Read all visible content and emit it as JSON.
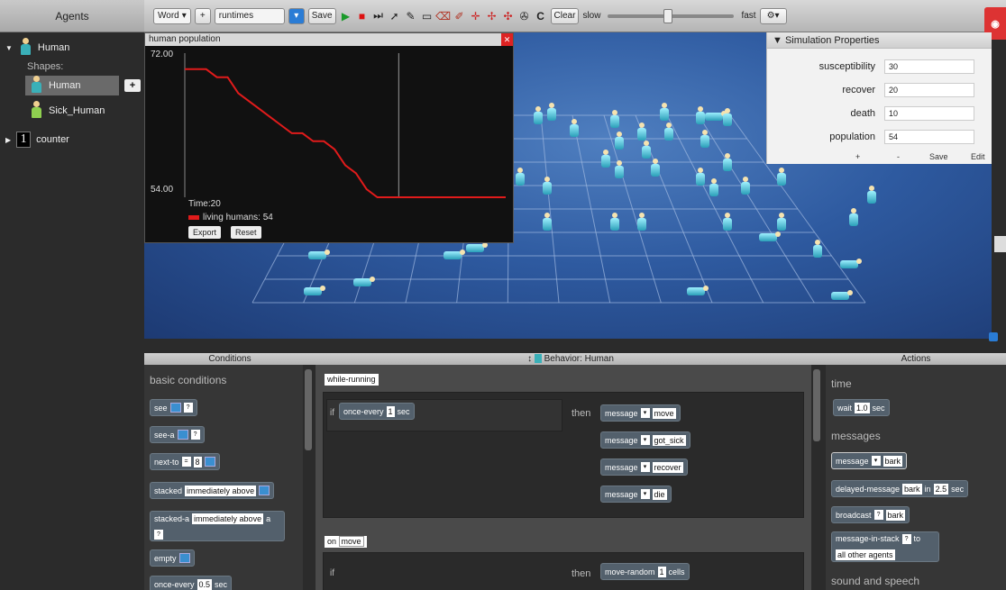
{
  "agents_panel": {
    "header": "Agents",
    "agent_name": "Human",
    "shapes_label": "Shapes:",
    "shapes": [
      "Human",
      "Sick_Human"
    ],
    "counter_icon": "1",
    "counter_label": "counter",
    "add_button": "+"
  },
  "toolbar": {
    "world_select": "Word",
    "runtime_select": "runtimes",
    "save": "Save",
    "clear": "Clear",
    "slow": "slow",
    "fast": "fast",
    "tools": [
      "play-icon",
      "stop-icon",
      "step-icon",
      "pointer-icon",
      "pencil-icon",
      "eraser-icon",
      "brush-icon",
      "hand-icon",
      "cross-icon",
      "move-icon",
      "camera-icon"
    ],
    "settings_icon": "gear-icon"
  },
  "plot_window": {
    "title": "human population",
    "y_max": "72.00",
    "y_min": "54.00",
    "time_text": "Time:20",
    "legend": "living humans: 54",
    "export": "Export",
    "reset": "Reset"
  },
  "chart_data": {
    "type": "line",
    "series": [
      {
        "name": "living humans",
        "color": "#e01b1b",
        "x": [
          0,
          2,
          3,
          4,
          5,
          6,
          7,
          8,
          9,
          10,
          11,
          12,
          13,
          14,
          15,
          16,
          17,
          18,
          19,
          20
        ],
        "values": [
          70,
          70,
          69,
          69,
          67,
          66,
          65,
          64,
          63,
          62,
          62,
          61,
          61,
          60,
          58,
          57,
          55,
          54,
          54,
          54
        ]
      }
    ],
    "ylim": [
      54,
      72
    ],
    "xlim": [
      0,
      30
    ]
  },
  "sim_properties": {
    "title": "Simulation Properties",
    "rows": [
      {
        "label": "susceptibility",
        "value": "30"
      },
      {
        "label": "recover",
        "value": "20"
      },
      {
        "label": "death",
        "value": "10"
      },
      {
        "label": "population",
        "value": "54"
      }
    ],
    "buttons": [
      "+",
      "-",
      "Save",
      "Edit"
    ]
  },
  "conditions": {
    "header": "Conditions",
    "section": "basic conditions",
    "tiles": [
      "see",
      "see-a",
      "next-to",
      "stacked",
      "stacked-a",
      "empty",
      "once-every"
    ],
    "stacked_value": "immediately above",
    "stacked_a_value": "immediately above",
    "once_every_value": "0.5",
    "once_every_unit": "sec",
    "next_to_value": "8"
  },
  "behavior": {
    "header": "Behavior: Human",
    "method1": "while-running",
    "if_label": "if",
    "then_label": "then",
    "condition": "once-every",
    "condition_value": "1",
    "condition_unit": "sec",
    "messages": [
      "move",
      "got_sick",
      "recover",
      "die"
    ],
    "message_label": "message",
    "method2_prefix": "on",
    "method2": "move",
    "move_random": "move-random",
    "move_random_value": "1",
    "move_random_unit": "cells"
  },
  "actions": {
    "header": "Actions",
    "section_time": "time",
    "wait": "wait",
    "wait_value": "1.0",
    "wait_unit": "sec",
    "section_messages": "messages",
    "message": "message",
    "message_value": "bark",
    "delayed": "delayed-message",
    "delayed_value": "bark",
    "delayed_in": "in",
    "delayed_time": "2.5",
    "delayed_unit": "sec",
    "broadcast": "broadcast",
    "broadcast_value": "bark",
    "in_stack": "message-in-stack",
    "in_stack_to": "to",
    "in_stack_target": "all other agents",
    "section_sound": "sound and speech"
  },
  "colors": {
    "world_bg": "#2e5aa0",
    "line": "#e01b1b",
    "tile_bg": "#53606c"
  }
}
